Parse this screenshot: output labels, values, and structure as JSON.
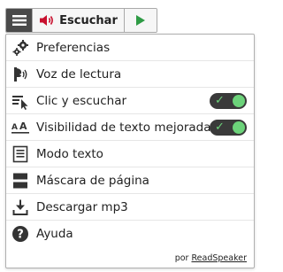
{
  "toolbar": {
    "menu_icon": "hamburger-icon",
    "listen_icon": "speaker-icon",
    "listen_label": "Escuchar",
    "play_icon": "play-icon",
    "accent_color": "#2e9b45",
    "speaker_color": "#c8102e"
  },
  "menu": {
    "items": [
      {
        "label": "Preferencias",
        "icon": "gears-icon"
      },
      {
        "label": "Voz de lectura",
        "icon": "voice-icon"
      },
      {
        "label": "Clic y escuchar",
        "icon": "click-listen-icon",
        "toggle": true,
        "toggle_on": true
      },
      {
        "label": "Visibilidad de texto mejorada",
        "icon": "text-visibility-icon",
        "toggle": true,
        "toggle_on": true
      },
      {
        "label": "Modo texto",
        "icon": "text-mode-icon"
      },
      {
        "label": "Máscara de página",
        "icon": "page-mask-icon"
      },
      {
        "label": "Descargar mp3",
        "icon": "download-icon"
      },
      {
        "label": "Ayuda",
        "icon": "help-icon"
      }
    ],
    "toggle_check": "✓",
    "toggle_color": "#6cd37a"
  },
  "footer": {
    "prefix": "por",
    "link": "ReadSpeaker"
  }
}
